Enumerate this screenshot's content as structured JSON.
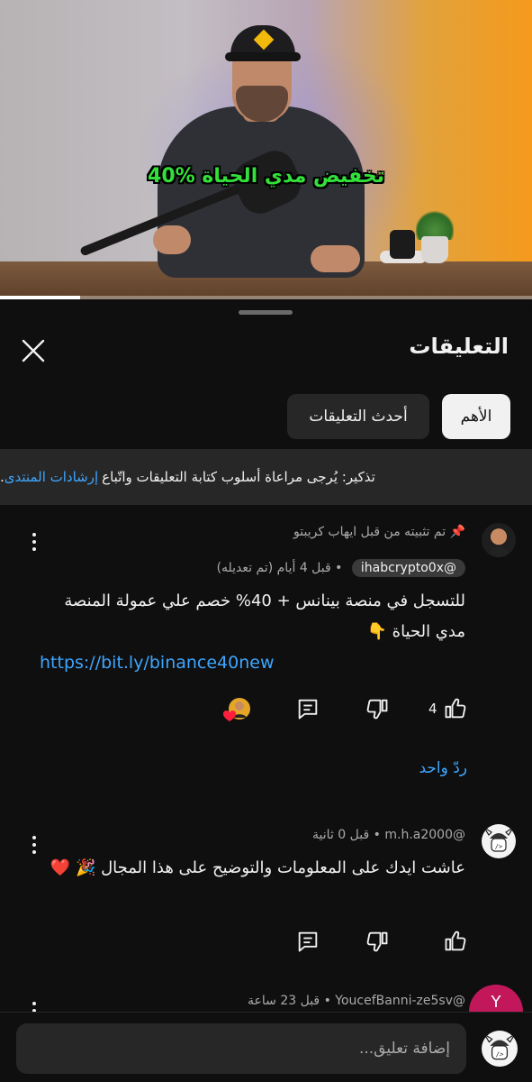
{
  "video": {
    "caption": "40% تخفيض مدي الحياة",
    "progress_percent": 15
  },
  "panel": {
    "title": "التعليقات",
    "chips": [
      {
        "label": "الأهم",
        "active": true
      },
      {
        "label": "أحدث التعليقات",
        "active": false
      }
    ],
    "notice": {
      "text": "تذكير: يُرجى مراعاة أسلوب كتابة التعليقات واتّباع",
      "link": "إرشادات المنتدى"
    }
  },
  "comments": [
    {
      "pinned_text": "تم تثبيته من قبل ايهاب كريبتو",
      "author": "@ihabcrypto0x",
      "time": "قبل 4 أيام (تم تعديله)",
      "body": "للتسجل في منصة بينانس + 40% خصم علي عمولة المنصة مدي الحياة 👇",
      "link": "https://bit.ly/binance40new",
      "likes": "4",
      "replies_label": "ردّ واحد"
    },
    {
      "author": "@m.h.a2000",
      "time": "قبل 0 ثانية",
      "body": "عاشت ايدك على المعلومات  والتوضيح على هذا المجال 🎉 ❤️"
    },
    {
      "author": "@YoucefBanni-ze5sv",
      "time": "قبل 23 ساعة",
      "avatar_letter": "Y"
    }
  ],
  "input": {
    "placeholder": "إضافة تعليق..."
  },
  "colors": {
    "background": "#0f0f0f",
    "chip_active": "#f1f1f1",
    "chip_inactive": "#272727",
    "link": "#3ea6ff",
    "caption_green": "#33e03a"
  }
}
